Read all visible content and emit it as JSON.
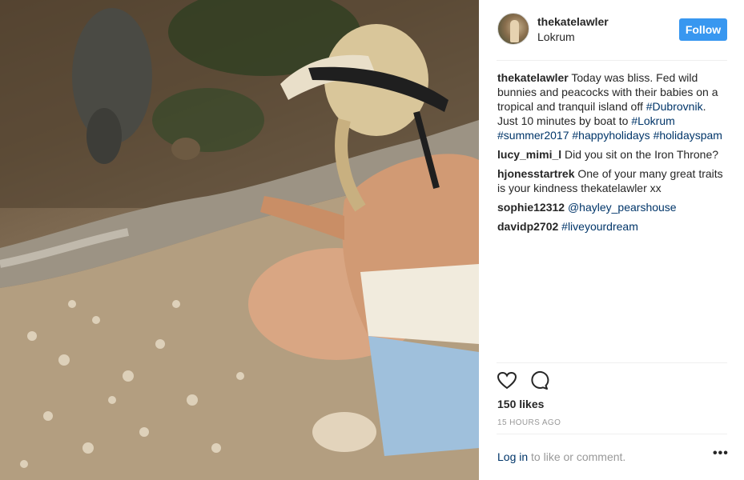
{
  "post": {
    "username": "thekatelawler",
    "location": "Lokrum",
    "follow_label": "Follow",
    "caption": {
      "author": "thekatelawler",
      "text": "Today was bliss. Fed wild bunnies and peacocks with their babies on a tropical and tranquil island off",
      "tag_dubrovnik": "#Dubrovnik",
      "text2": ". Just 10 minutes by boat to",
      "tag_lokrum": "#Lokrum",
      "tag_summer": "#summer2017",
      "tag_happy": "#happyholidays",
      "tag_spam": "#holidayspam"
    },
    "comments": [
      {
        "author": "lucy_mimi_l",
        "text": "Did you sit on the Iron Throne?"
      },
      {
        "author": "hjonesstartrek",
        "text": "One of your many great traits is your kindness thekatelawler xx"
      },
      {
        "author": "sophie12312",
        "link": "@hayley_pearshouse"
      },
      {
        "author": "davidp2702",
        "link": "#liveyourdream"
      }
    ],
    "likes": "150 likes",
    "timestamp": "15 HOURS AGO",
    "login_link": "Log in",
    "login_suffix": "to like or comment.",
    "more": "•••",
    "icons": {
      "like": "heart-icon",
      "comment": "comment-icon",
      "more": "more-options-icon"
    },
    "colors": {
      "follow_button": "#3897f0",
      "link": "#003569",
      "muted": "#999999"
    }
  }
}
